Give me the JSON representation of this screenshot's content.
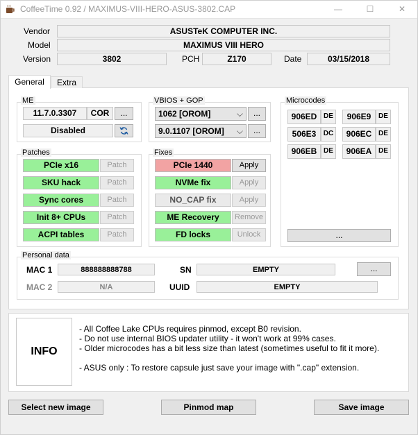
{
  "window": {
    "title": "CoffeeTime 0.92  /  MAXIMUS-VIII-HERO-ASUS-3802.CAP",
    "minimize_glyph": "—",
    "maximize_glyph": "☐",
    "close_glyph": "✕"
  },
  "header": {
    "vendor_label": "Vendor",
    "vendor_value": "ASUSTeK COMPUTER INC.",
    "model_label": "Model",
    "model_value": "MAXIMUS VIII HERO",
    "version_label": "Version",
    "version_value": "3802",
    "pch_label": "PCH",
    "pch_value": "Z170",
    "date_label": "Date",
    "date_value": "03/15/2018"
  },
  "tabs": [
    {
      "label": "General",
      "active": true
    },
    {
      "label": "Extra",
      "active": false
    }
  ],
  "me": {
    "title": "ME",
    "version": "11.7.0.3307",
    "type": "COR",
    "more": "...",
    "status": "Disabled",
    "refresh_icon": "refresh-icon"
  },
  "vbios": {
    "title": "VBIOS + GOP",
    "vbios_value": "1062 [OROM]",
    "gop_value": "9.0.1107 [OROM]",
    "more": "...",
    "chevron": "⌵"
  },
  "microcodes": {
    "title": "Microcodes",
    "items": [
      {
        "code": "906ED",
        "tag": "DE"
      },
      {
        "code": "906E9",
        "tag": "DE"
      },
      {
        "code": "506E3",
        "tag": "DC"
      },
      {
        "code": "906EC",
        "tag": "DE"
      },
      {
        "code": "906EB",
        "tag": "DE"
      },
      {
        "code": "906EA",
        "tag": "DE"
      }
    ],
    "more": "..."
  },
  "patches": {
    "title": "Patches",
    "items": [
      {
        "label": "PCIe x16",
        "action": "Patch"
      },
      {
        "label": "SKU hack",
        "action": "Patch"
      },
      {
        "label": "Sync cores",
        "action": "Patch"
      },
      {
        "label": "Init 8+ CPUs",
        "action": "Patch"
      },
      {
        "label": "ACPI tables",
        "action": "Patch"
      }
    ]
  },
  "fixes": {
    "title": "Fixes",
    "items": [
      {
        "label": "PCIe 1440",
        "action": "Apply",
        "state": "red",
        "enabled": true
      },
      {
        "label": "NVMe fix",
        "action": "Apply",
        "state": "green",
        "enabled": false
      },
      {
        "label": "NO_CAP fix",
        "action": "Apply",
        "state": "gray",
        "enabled": false
      },
      {
        "label": "ME Recovery",
        "action": "Remove",
        "state": "green",
        "enabled": false
      },
      {
        "label": "FD locks",
        "action": "Unlock",
        "state": "green",
        "enabled": false
      }
    ]
  },
  "personal": {
    "title": "Personal data",
    "mac1_label": "MAC 1",
    "mac1_value": "888888888788",
    "mac2_label": "MAC 2",
    "mac2_value": "N/A",
    "sn_label": "SN",
    "sn_value": "EMPTY",
    "uuid_label": "UUID",
    "uuid_value": "EMPTY",
    "more": "..."
  },
  "info": {
    "label": "INFO",
    "lines": [
      "- All Coffee Lake CPUs requires pinmod, except B0 revision.",
      "- Do not use internal BIOS updater utility - it won't work at 99% cases.",
      "- Older microcodes has a bit less size than latest (sometimes useful to fit it more).",
      "- ASUS only : To restore capsule just save your image with \".cap\" extension."
    ]
  },
  "footer": {
    "select_label": "Select new image",
    "pinmod_label": "Pinmod map",
    "save_label": "Save image"
  },
  "colors": {
    "green": "#99f099",
    "red": "#f2a3a3"
  }
}
